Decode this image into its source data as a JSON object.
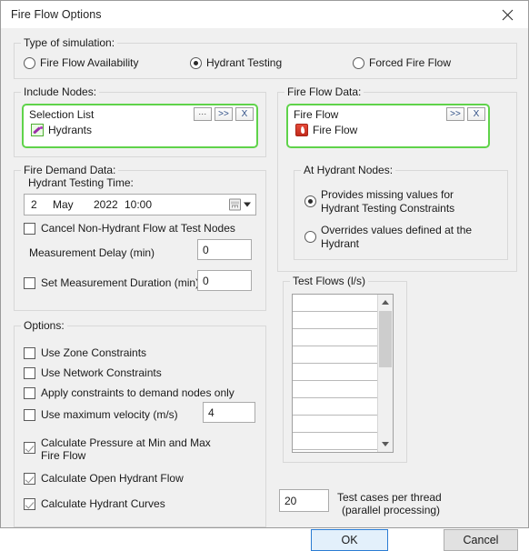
{
  "window": {
    "title": "Fire Flow Options",
    "close_icon": "close-icon"
  },
  "simulation_type": {
    "legend": "Type of simulation:",
    "options": [
      {
        "label": "Fire Flow Availability",
        "selected": false
      },
      {
        "label": "Hydrant Testing",
        "selected": true
      },
      {
        "label": "Forced Fire Flow",
        "selected": false
      }
    ]
  },
  "include_nodes": {
    "legend": "Include Nodes:",
    "pane_title": "Selection List",
    "buttons": [
      "...",
      ">>",
      "X"
    ],
    "item": {
      "label": "Hydrants",
      "icon": "hydrant-selection-icon"
    }
  },
  "fire_flow_data": {
    "legend": "Fire Flow Data:",
    "pane_title": "Fire Flow",
    "buttons": [
      ">>",
      "X"
    ],
    "item": {
      "label": "Fire Flow",
      "icon": "fire-flow-icon"
    },
    "at_hydrant_nodes": {
      "legend": "At Hydrant Nodes:",
      "options": [
        {
          "label": "Provides missing values for Hydrant Testing Constraints",
          "selected": true
        },
        {
          "label": "Overrides values defined at the Hydrant",
          "selected": false
        }
      ]
    }
  },
  "fire_demand_data": {
    "legend": "Fire Demand Data:",
    "time_label": "Hydrant Testing Time:",
    "datetime": {
      "day": "2",
      "month": "May",
      "year": "2022",
      "time": "10:00"
    },
    "cancel_non_hydrant": {
      "label": "Cancel Non-Hydrant Flow at Test Nodes",
      "checked": false
    },
    "measurement_delay": {
      "label": "Measurement Delay (min)",
      "value": "0"
    },
    "set_measurement_duration": {
      "label": "Set Measurement Duration (min)",
      "checked": false,
      "value": "0"
    }
  },
  "options": {
    "legend": "Options:",
    "items": [
      {
        "label": "Use Zone Constraints",
        "checked": false
      },
      {
        "label": "Use Network Constraints",
        "checked": false
      },
      {
        "label": "Apply constraints to demand nodes only",
        "checked": false
      },
      {
        "label": "Use maximum velocity (m/s)",
        "checked": false,
        "value": "4"
      },
      {
        "label": "Calculate Pressure at Min and Max Fire Flow",
        "checked": true
      },
      {
        "label": "Calculate Open Hydrant Flow",
        "checked": true
      },
      {
        "label": "Calculate Hydrant Curves",
        "checked": true
      }
    ]
  },
  "test_flows": {
    "legend": "Test Flows (l/s)",
    "rows": [
      "",
      "",
      "",
      "",
      "",
      "",
      "",
      "",
      "",
      ""
    ],
    "scrollbar": {
      "up": "scroll-up-icon",
      "down": "scroll-down-icon"
    }
  },
  "threads": {
    "value": "20",
    "label_line1": "Test cases per thread",
    "label_line2": "(parallel processing)"
  },
  "footer": {
    "ok": "OK",
    "cancel": "Cancel"
  },
  "colors": {
    "accent_green": "#5fd34a",
    "primary_blue": "#2b7cd3",
    "fire_red": "#c22a1c"
  }
}
